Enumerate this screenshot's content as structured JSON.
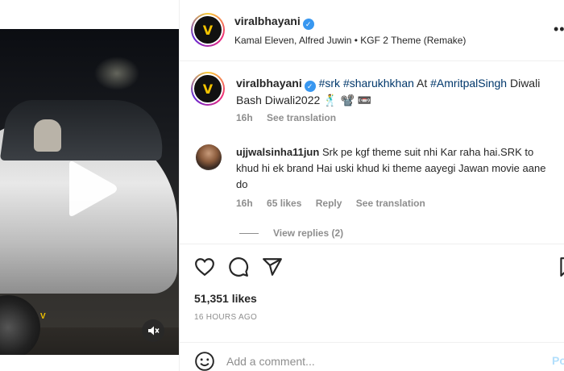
{
  "post": {
    "username": "viralbhayani",
    "avatar_letter": "V",
    "audio": "Kamal Eleven, Alfred Juwin • KGF 2 Theme (Remake)",
    "more_glyph": "•••"
  },
  "caption": {
    "username": "viralbhayani",
    "tags_pre": [
      "#srk",
      "#sharukhkhan"
    ],
    "at_word": "At",
    "mention": "#AmritpalSingh",
    "rest": "Diwali Bash Diwali2022 🕺 📽️ 📼",
    "time": "16h",
    "translate": "See translation"
  },
  "comment": {
    "username": "ujjwalsinha11jun",
    "text": "Srk pe kgf theme suit nhi Kar raha hai.SRK to khud hi ek brand Hai uski khud ki theme aayegi Jawan movie aane do",
    "time": "16h",
    "likes": "65 likes",
    "reply": "Reply",
    "translate": "See translation",
    "view_replies": "View replies (2)"
  },
  "stats": {
    "likes": "51,351 likes",
    "time_ago": "16 HOURS AGO"
  },
  "composer": {
    "placeholder": "Add a comment...",
    "post_label": "Po"
  },
  "video": {
    "badge": "V"
  },
  "colors": {
    "link": "#00376b",
    "verified": "#3897f0",
    "muted": "#8e8e8e",
    "post_disabled": "#b2dffc"
  }
}
